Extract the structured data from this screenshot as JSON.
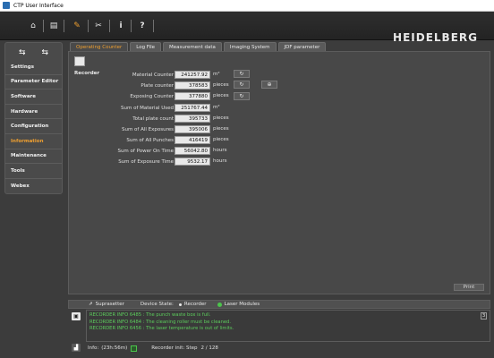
{
  "window": {
    "title": "CTP User Interface"
  },
  "toolbar": {
    "brand": "HEIDELBERG",
    "buttons": [
      {
        "name": "factory-icon",
        "glyph": "⌂"
      },
      {
        "name": "document-icon",
        "glyph": "▤"
      },
      {
        "name": "wrench-icon",
        "glyph": "✎"
      },
      {
        "name": "tools-icon",
        "glyph": "✂"
      },
      {
        "name": "info-icon",
        "glyph": "i"
      },
      {
        "name": "help-icon",
        "glyph": "?"
      }
    ]
  },
  "sidebar": {
    "items": [
      {
        "label": "Settings",
        "active": false
      },
      {
        "label": "Parameter Editor",
        "active": false
      },
      {
        "label": "Software",
        "active": false
      },
      {
        "label": "Hardware",
        "active": false
      },
      {
        "label": "Configuration",
        "active": false
      },
      {
        "label": "Information",
        "active": true
      },
      {
        "label": "Maintenance",
        "active": false
      },
      {
        "label": "Tools",
        "active": false
      },
      {
        "label": "Webex",
        "active": false
      }
    ]
  },
  "tabs": [
    {
      "label": "Operating Counter",
      "active": true
    },
    {
      "label": "Log File",
      "active": false
    },
    {
      "label": "Measurement data",
      "active": false
    },
    {
      "label": "Imaging System",
      "active": false
    },
    {
      "label": "JDF parameter",
      "active": false
    }
  ],
  "panel": {
    "section": "Recorder",
    "counters": [
      {
        "label": "Material Counter",
        "value": "241257.92",
        "unit": "m²"
      },
      {
        "label": "Plate counter",
        "value": "378583",
        "unit": "pieces"
      },
      {
        "label": "Exposing Counter",
        "value": "377880",
        "unit": "pieces"
      },
      {
        "label": "Sum of Material Used",
        "value": "251767.44",
        "unit": "m²"
      },
      {
        "label": "Total plate count",
        "value": "395733",
        "unit": "pieces"
      },
      {
        "label": "Sum of All Exposures",
        "value": "395006",
        "unit": "pieces"
      },
      {
        "label": "Sum of All Punches",
        "value": "416419",
        "unit": "pieces"
      },
      {
        "label": "Sum of Power On Time",
        "value": "56042.80",
        "unit": "hours"
      },
      {
        "label": "Sum of Exposure Time",
        "value": "9532.17",
        "unit": "hours"
      }
    ],
    "print_label": "Print"
  },
  "status": {
    "device": "Suprasetter",
    "state_label": "Device State:",
    "recorder_label": "Recorder",
    "laser_label": "Laser Modules",
    "recorder_color": "#e8e8e8",
    "laser_color": "#4cc44c"
  },
  "messages": {
    "count": "3",
    "lines": [
      "RECORDER INFO 6485 : The punch waste box is full.",
      "RECORDER INFO 6484 : The cleaning roller must be cleaned.",
      "RECORDER INFO 6456 : The laser temperature is out of limits."
    ]
  },
  "info": {
    "label": "Info:",
    "uptime": "(23h:56m)",
    "step_label": "Recorder init: Step",
    "step_value": "2 / 128"
  }
}
